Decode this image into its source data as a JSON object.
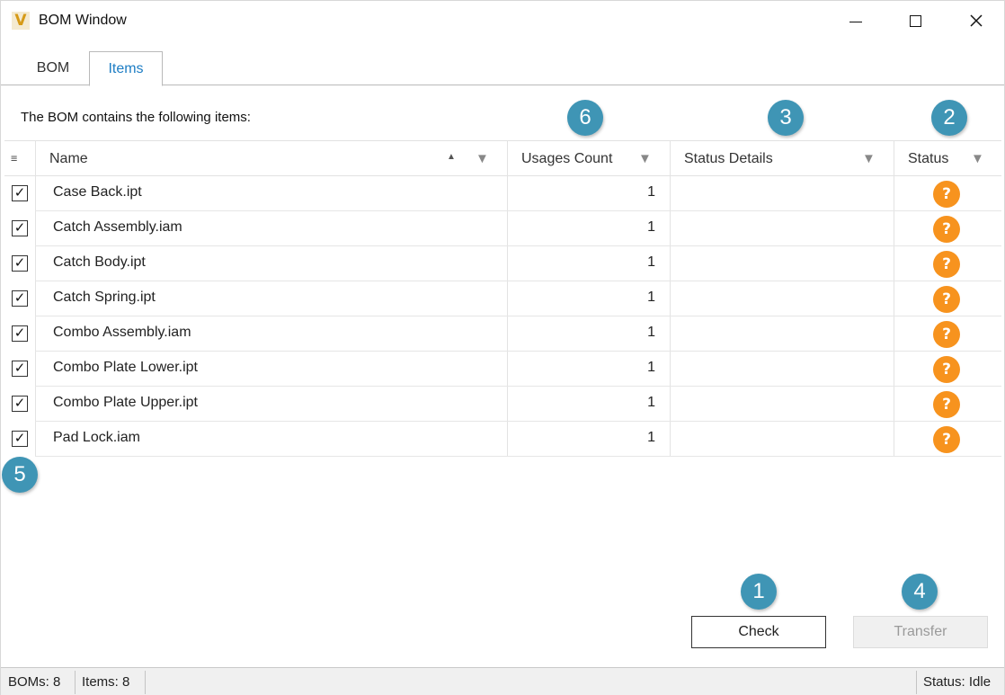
{
  "window": {
    "title": "BOM Window",
    "logo_letter": "V"
  },
  "tabs": [
    {
      "label": "BOM",
      "active": false
    },
    {
      "label": "Items",
      "active": true
    }
  ],
  "intro_text": "The BOM contains the following items:",
  "columns": {
    "name": "Name",
    "usages": "Usages Count",
    "status_details": "Status Details",
    "status": "Status"
  },
  "rows": [
    {
      "checked": true,
      "name": "Case Back.ipt",
      "usages": "1",
      "status_details": "",
      "status_icon": "question-icon"
    },
    {
      "checked": true,
      "name": "Catch Assembly.iam",
      "usages": "1",
      "status_details": "",
      "status_icon": "question-icon"
    },
    {
      "checked": true,
      "name": "Catch Body.ipt",
      "usages": "1",
      "status_details": "",
      "status_icon": "question-icon"
    },
    {
      "checked": true,
      "name": "Catch Spring.ipt",
      "usages": "1",
      "status_details": "",
      "status_icon": "question-icon"
    },
    {
      "checked": true,
      "name": "Combo Assembly.iam",
      "usages": "1",
      "status_details": "",
      "status_icon": "question-icon"
    },
    {
      "checked": true,
      "name": "Combo Plate Lower.ipt",
      "usages": "1",
      "status_details": "",
      "status_icon": "question-icon"
    },
    {
      "checked": true,
      "name": "Combo Plate Upper.ipt",
      "usages": "1",
      "status_details": "",
      "status_icon": "question-icon"
    },
    {
      "checked": true,
      "name": "Pad Lock.iam",
      "usages": "1",
      "status_details": "",
      "status_icon": "question-icon"
    }
  ],
  "callouts": [
    "1",
    "2",
    "3",
    "4",
    "5",
    "6"
  ],
  "buttons": {
    "check": "Check",
    "transfer": "Transfer",
    "transfer_enabled": false
  },
  "statusbar": {
    "boms": "BOMs: 8",
    "items": "Items: 8",
    "status": "Status: Idle"
  },
  "colors": {
    "accent_tab": "#1d7dc4",
    "status_unknown": "#f7931e",
    "callout": "#3f95b5"
  },
  "icons": {
    "question": "?",
    "check": "✓",
    "filter": "▼",
    "sort_asc": "▲"
  }
}
